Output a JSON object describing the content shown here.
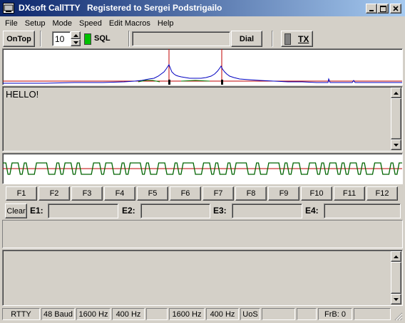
{
  "window": {
    "app_name": "DXsoft CallTTY",
    "registration": "Registered to Sergei Podstrigailo"
  },
  "menu": [
    "File",
    "Setup",
    "Mode",
    "Speed",
    "Edit Macros",
    "Help"
  ],
  "toolbar": {
    "ontop_label": "OnTop",
    "speed_value": "10",
    "sql_label": "SQL",
    "call_input_value": "",
    "dial_label": "Dial",
    "tx_label": "TX"
  },
  "receive_text": "HELLO!",
  "function_keys": [
    "F1",
    "F2",
    "F3",
    "F4",
    "F5",
    "F6",
    "F7",
    "F8",
    "F9",
    "F10",
    "F11",
    "F12"
  ],
  "edit_row": {
    "clear_label": "Clear",
    "e1_label": "E1:",
    "e2_label": "E2:",
    "e3_label": "E3:",
    "e4_label": "E4:"
  },
  "status": {
    "mode": "RTTY",
    "baud": "48 Baud",
    "mark": "1600 Hz",
    "shift": "400 Hz",
    "mark2": "1600 Hz",
    "shift2": "400 Hz",
    "uos": "UoS",
    "frb": "FrB: 0"
  },
  "colors": {
    "title_start": "#0a246a",
    "title_end": "#a6caf0",
    "spectrum_trace": "#0000c0",
    "marker_red": "#c00000",
    "tuning_green": "#006400",
    "sql_led": "#00c000"
  }
}
